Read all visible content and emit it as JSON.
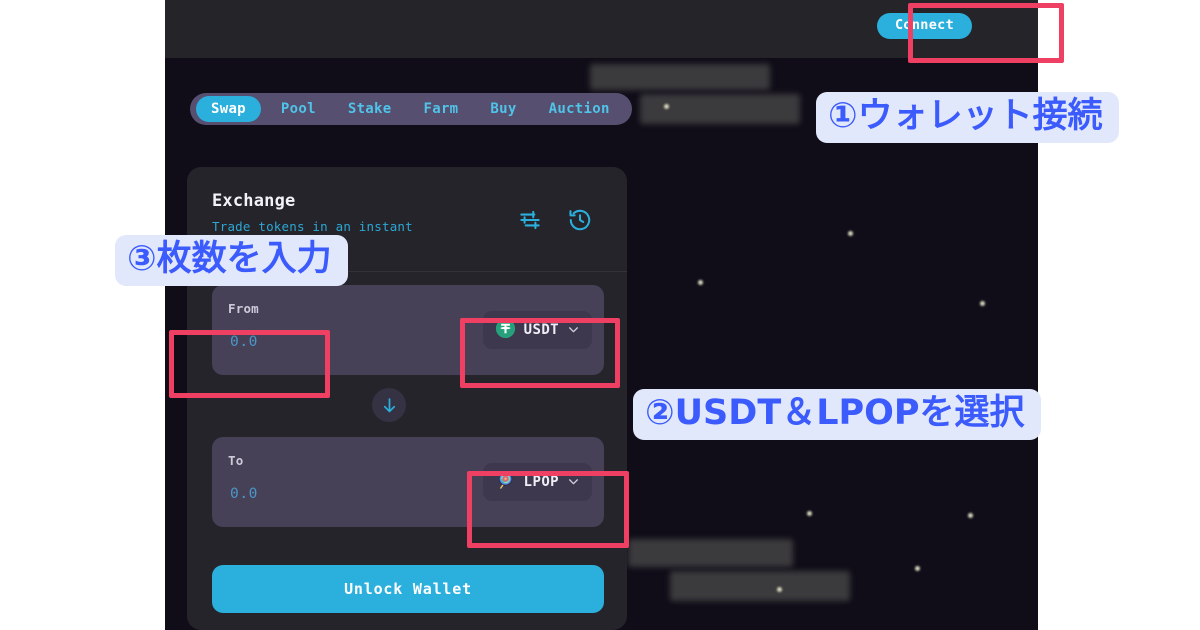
{
  "app": {
    "topbar": {
      "connect_label": "Connect"
    },
    "tabs": [
      {
        "label": "Swap",
        "active": true
      },
      {
        "label": "Pool",
        "active": false
      },
      {
        "label": "Stake",
        "active": false
      },
      {
        "label": "Farm",
        "active": false
      },
      {
        "label": "Buy",
        "active": false
      },
      {
        "label": "Auction",
        "active": false
      }
    ],
    "exchange_card": {
      "title": "Exchange",
      "subtitle": "Trade tokens in an instant",
      "settings_icon": "sliders-icon",
      "history_icon": "clock-history-icon",
      "from": {
        "label": "From",
        "amount": "0.0",
        "placeholder": "0.0",
        "token": "USDT",
        "token_icon": "usdt-tether-icon",
        "token_icon_color": "#26a17b",
        "caret": "⌄"
      },
      "to": {
        "label": "To",
        "amount": "0.0",
        "placeholder": "0.0",
        "token": "LPOP",
        "token_icon": "lollipop-icon",
        "caret": "⌄"
      },
      "swap_direction_icon": "arrow-down-icon",
      "action_button": "Unlock Wallet"
    }
  },
  "annotations": [
    {
      "id": "1",
      "text": "①ウォレット接続"
    },
    {
      "id": "2",
      "text": "②USDT＆LPOPを選択"
    },
    {
      "id": "3",
      "text": "③枚数を入力"
    }
  ],
  "colors": {
    "accent_cyan": "#2bafdd",
    "highlight_red": "#ef3f62",
    "callout_bg": "#e2e8fb",
    "callout_text": "#3b5bfd",
    "app_bg": "#100d18",
    "topbar_bg": "#252529",
    "card_bg": "#26242b",
    "row_bg": "#474157",
    "tabbar_bg": "#564f6f"
  }
}
